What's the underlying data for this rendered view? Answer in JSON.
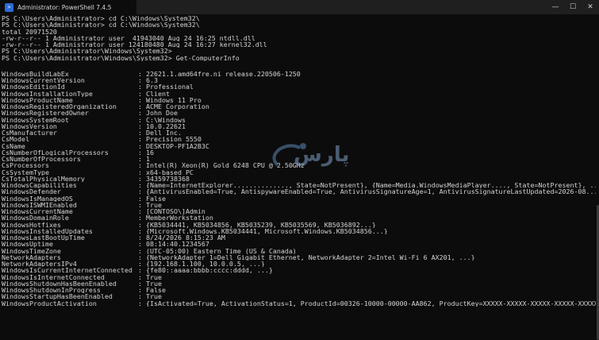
{
  "window": {
    "tab_title": "Administrator: PowerShell 7.4.5",
    "icon": "powershell-icon",
    "controls": [
      "minimize-icon",
      "maximize-icon",
      "close-icon"
    ]
  },
  "terminal": {
    "pre_lines": [
      "PS C:\\Users\\Administrator> cd C:\\Windows\\System32\\",
      "PS C:\\Users\\Administrator> cd C:\\Windows\\System32\\",
      "total 20971520",
      "-rw-r--r-- 1 Administrator user  41943040 Aug 24 16:25 ntdll.dll",
      "-rw-r--r-- 1 Administrator user 124180480 Aug 24 16:27 kernel32.dll",
      "PS C:\\Users\\Administrator\\Windows\\System32>",
      "PS C:\\Users\\Administrator\\Windows\\System32> Get-ComputerInfo"
    ],
    "properties": [
      {
        "name": "WindowsBuildLabEx",
        "value": ": 22621.1.amd64fre.ni_release.220506-1250"
      },
      {
        "name": "WindowsCurrentVersion",
        "value": ": 6.3"
      },
      {
        "name": "WindowsEditionId",
        "value": ": Professional"
      },
      {
        "name": "WindowsInstallationType",
        "value": ": Client"
      },
      {
        "name": "WindowsProductName",
        "value": ": Windows 11 Pro"
      },
      {
        "name": "WindowsRegisteredOrganization",
        "value": ": ACME Corporation"
      },
      {
        "name": "WindowsRegisteredOwner",
        "value": ": John Doe"
      },
      {
        "name": "WindowsSystemRoot",
        "value": ": C:\\Windows"
      },
      {
        "name": "WindowsVersion",
        "value": ": 10.0.22621"
      },
      {
        "name": "CsManufacturer",
        "value": ": Dell Inc."
      },
      {
        "name": "CsModel",
        "value": ": Precision 5550"
      },
      {
        "name": "CsName",
        "value": ": DESKTOP-PF1A2B3C"
      },
      {
        "name": "CsNumberOfLogicalProcessors",
        "value": ": 16"
      },
      {
        "name": "CsNumberOfProcessors",
        "value": ": 1"
      },
      {
        "name": "CsProcessors",
        "value": ": Intel(R) Xeon(R) Gold 6248 CPU @ 2.50GHz"
      },
      {
        "name": "CsSystemType",
        "value": ": x64-based PC"
      },
      {
        "name": "CsTotalPhysicalMemory",
        "value": ": 34359738368"
      },
      {
        "name": "WindowsCapabilities",
        "value": ": {Name=InternetExplorer.............., State=NotPresent}, {Name=Media.WindowsMediaPlayer...., State=NotPresent}, ..."
      },
      {
        "name": "WindowsDefender",
        "value": ": {AntivirusEnabled=True, AntispywareEnabled=True, AntivirusSignatureAge=1, AntivirusSignatureLastUpdated=2026-08..."
      },
      {
        "name": "WindowsIsManagedOS",
        "value": ": False"
      },
      {
        "name": "WindowsISWMIEnabled",
        "value": ": True"
      },
      {
        "name": "WindowsCurrentName",
        "value": ": [CONTOSO\\]Admin"
      },
      {
        "name": "WindowsDomainRole",
        "value": ": MemberWorkstation"
      },
      {
        "name": "WindowsHotfixes",
        "value": ": {KB5034441, KB5034856, KB5035239, KB5035569, KB5036892...}"
      },
      {
        "name": "WindowsInstalledUpdates",
        "value": ": {Microsoft.Windows.KB5034441, Microsoft.Windows.KB5034856...}"
      },
      {
        "name": "WindowsLastBootUpTime",
        "value": ": 8/24/2026 8:15:23 AM"
      },
      {
        "name": "WindowsUptime",
        "value": ": 08:14:40.1234567"
      },
      {
        "name": "WindowsTimeZone",
        "value": ": (UTC-05:00) Eastern Time (US & Canada)"
      },
      {
        "name": "NetworkAdapters",
        "value": ": {NetworkAdapter_1=Dell Gigabit Ethernet, NetworkAdapter_2=Intel Wi-Fi 6 AX201, ...}"
      },
      {
        "name": "NetworkAdaptersIPv4",
        "value": ": {192.168.1.100, 10.0.0.5, ...}"
      },
      {
        "name": "WindowsIsCurrentInternetConnected",
        "value": ": {fe80::aaaa:bbbb:cccc:dddd, ...}"
      },
      {
        "name": "WindowsIsInternetConnected",
        "value": ": True"
      },
      {
        "name": "WindowsShutdownHasBeenEnabled",
        "value": ": True"
      },
      {
        "name": "WindowsShutdownInProgress",
        "value": ": False"
      },
      {
        "name": "WindowsStartupHasBeenEnabled",
        "value": ": True"
      },
      {
        "name": "WindowsProductActivation",
        "value": ": {IsActivated=True, ActivationStatus=1, ProductId=00326-10000-00000-AA862, ProductKey=XXXXX-XXXXX-XXXXX-XXXXX-XXXXX}"
      }
    ]
  },
  "watermark": {
    "text": "پارس",
    "color": "#7fa0c8"
  },
  "colors": {
    "background": "#0c0c0c",
    "text": "#d4d4d4",
    "titlebar": "#1f1f1f"
  }
}
